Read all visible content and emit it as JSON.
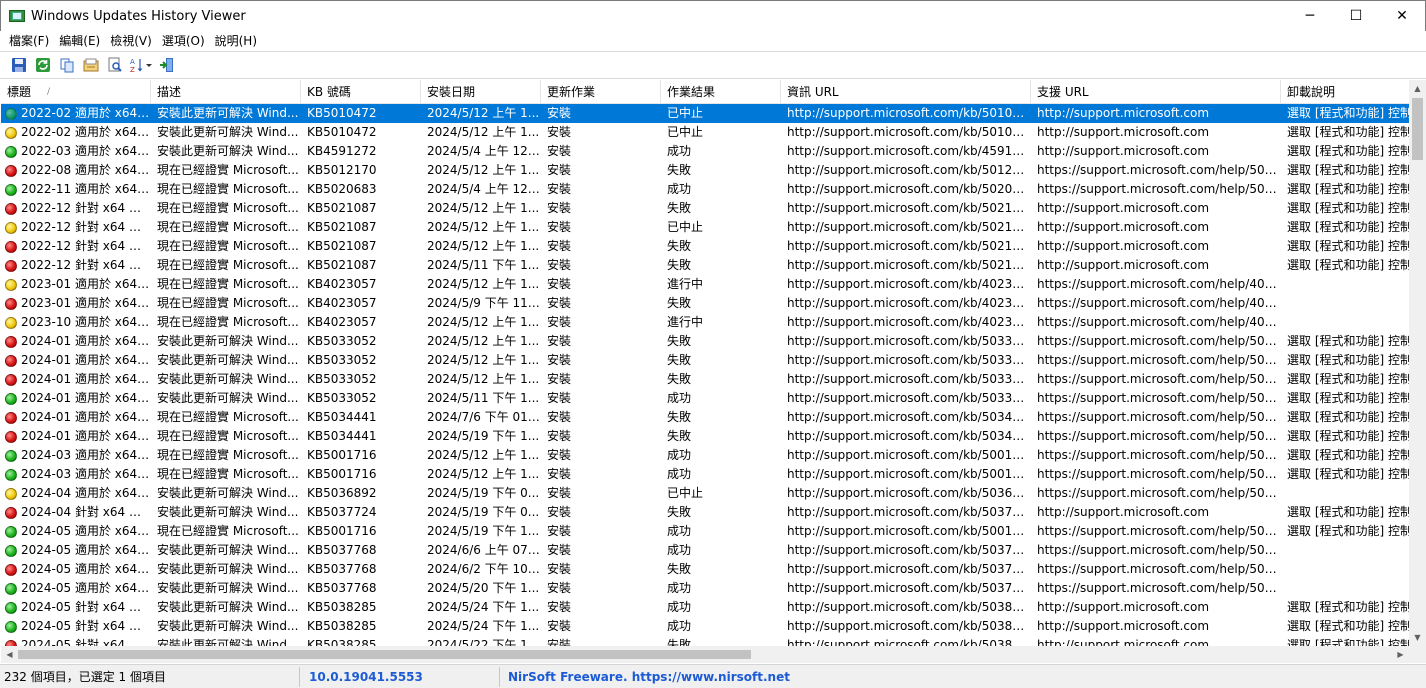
{
  "window": {
    "title": "Windows Updates History Viewer",
    "minimize_glyph": "─",
    "maximize_glyph": "☐",
    "close_glyph": "✕"
  },
  "menu": [
    "檔案(F)",
    "編輯(E)",
    "檢視(V)",
    "選項(O)",
    "說明(H)"
  ],
  "toolbar": {
    "icons": [
      "save-icon",
      "refresh-icon",
      "copy-icon",
      "properties-icon",
      "find-icon",
      "sort-icon",
      "exit-icon"
    ]
  },
  "columns": [
    {
      "label": "標題",
      "sort_indicator": "/"
    },
    {
      "label": "描述"
    },
    {
      "label": "KB 號碼"
    },
    {
      "label": "安裝日期"
    },
    {
      "label": "更新作業"
    },
    {
      "label": "作業結果"
    },
    {
      "label": "資訊 URL"
    },
    {
      "label": "支援 URL"
    },
    {
      "label": "卸載說明"
    }
  ],
  "status_colors": {
    "red": "#d81616",
    "green": "#1fb51f",
    "yellow": "#f3c90f",
    "selection": "#0078d7"
  },
  "rows": [
    {
      "status": "green",
      "selected": true,
      "cells": [
        "2022-02 適用於 x64 ...",
        "安裝此更新可解決 Wind...",
        "KB5010472",
        "2024/5/12 上午 1...",
        "安裝",
        "已中止",
        "http://support.microsoft.com/kb/5010472",
        "http://support.microsoft.com",
        "選取 [程式和功能] 控制"
      ]
    },
    {
      "status": "yellow",
      "cells": [
        "2022-02 適用於 x64 ...",
        "安裝此更新可解決 Wind...",
        "KB5010472",
        "2024/5/12 上午 1...",
        "安裝",
        "已中止",
        "http://support.microsoft.com/kb/5010472",
        "http://support.microsoft.com",
        "選取 [程式和功能] 控制"
      ]
    },
    {
      "status": "green",
      "cells": [
        "2022-03 適用於 x64 ...",
        "安裝此更新可解決 Wind...",
        "KB4591272",
        "2024/5/4 上午 12:...",
        "安裝",
        "成功",
        "http://support.microsoft.com/kb/4591272",
        "http://support.microsoft.com",
        "選取 [程式和功能] 控制"
      ]
    },
    {
      "status": "red",
      "cells": [
        "2022-08 適用於 x64 ...",
        "現在已經證實 Microsoft...",
        "KB5012170",
        "2024/5/12 上午 1...",
        "安裝",
        "失敗",
        "http://support.microsoft.com/kb/5012170",
        "https://support.microsoft.com/help/501...",
        "選取 [程式和功能] 控制"
      ]
    },
    {
      "status": "green",
      "cells": [
        "2022-11 適用於 x64 ...",
        "現在已經證實 Microsoft...",
        "KB5020683",
        "2024/5/4 上午 12:...",
        "安裝",
        "成功",
        "http://support.microsoft.com/kb/5020683",
        "https://support.microsoft.com/help/502...",
        "選取 [程式和功能] 控制"
      ]
    },
    {
      "status": "red",
      "cells": [
        "2022-12 針對 x64 之 ...",
        "現在已經證實 Microsoft...",
        "KB5021087",
        "2024/5/12 上午 1...",
        "安裝",
        "失敗",
        "http://support.microsoft.com/kb/5021087",
        "http://support.microsoft.com",
        "選取 [程式和功能] 控制"
      ]
    },
    {
      "status": "yellow",
      "cells": [
        "2022-12 針對 x64 之 ...",
        "現在已經證實 Microsoft...",
        "KB5021087",
        "2024/5/12 上午 1...",
        "安裝",
        "已中止",
        "http://support.microsoft.com/kb/5021087",
        "http://support.microsoft.com",
        "選取 [程式和功能] 控制"
      ]
    },
    {
      "status": "red",
      "cells": [
        "2022-12 針對 x64 之 ...",
        "現在已經證實 Microsoft...",
        "KB5021087",
        "2024/5/12 上午 1...",
        "安裝",
        "失敗",
        "http://support.microsoft.com/kb/5021087",
        "http://support.microsoft.com",
        "選取 [程式和功能] 控制"
      ]
    },
    {
      "status": "red",
      "cells": [
        "2022-12 針對 x64 之 ...",
        "現在已經證實 Microsoft...",
        "KB5021087",
        "2024/5/11 下午 1...",
        "安裝",
        "失敗",
        "http://support.microsoft.com/kb/5021087",
        "http://support.microsoft.com",
        "選取 [程式和功能] 控制"
      ]
    },
    {
      "status": "yellow",
      "cells": [
        "2023-01 適用於 x64 ...",
        "現在已經證實 Microsoft...",
        "KB4023057",
        "2024/5/12 上午 1...",
        "安裝",
        "進行中",
        "http://support.microsoft.com/kb/4023057",
        "https://support.microsoft.com/help/402...",
        ""
      ]
    },
    {
      "status": "red",
      "cells": [
        "2023-01 適用於 x64 ...",
        "現在已經證實 Microsoft...",
        "KB4023057",
        "2024/5/9 下午 11:...",
        "安裝",
        "失敗",
        "http://support.microsoft.com/kb/4023057",
        "https://support.microsoft.com/help/402...",
        ""
      ]
    },
    {
      "status": "yellow",
      "cells": [
        "2023-10 適用於 x64 ...",
        "現在已經證實 Microsoft...",
        "KB4023057",
        "2024/5/12 上午 1...",
        "安裝",
        "進行中",
        "http://support.microsoft.com/kb/4023057",
        "https://support.microsoft.com/help/402...",
        ""
      ]
    },
    {
      "status": "red",
      "cells": [
        "2024-01 適用於 x64 ...",
        "安裝此更新可解決 Wind...",
        "KB5033052",
        "2024/5/12 上午 1...",
        "安裝",
        "失敗",
        "http://support.microsoft.com/kb/5033052",
        "https://support.microsoft.com/help/503...",
        "選取 [程式和功能] 控制"
      ]
    },
    {
      "status": "red",
      "cells": [
        "2024-01 適用於 x64 ...",
        "安裝此更新可解決 Wind...",
        "KB5033052",
        "2024/5/12 上午 1...",
        "安裝",
        "失敗",
        "http://support.microsoft.com/kb/5033052",
        "https://support.microsoft.com/help/503...",
        "選取 [程式和功能] 控制"
      ]
    },
    {
      "status": "red",
      "cells": [
        "2024-01 適用於 x64 ...",
        "安裝此更新可解決 Wind...",
        "KB5033052",
        "2024/5/12 上午 1...",
        "安裝",
        "失敗",
        "http://support.microsoft.com/kb/5033052",
        "https://support.microsoft.com/help/503...",
        "選取 [程式和功能] 控制"
      ]
    },
    {
      "status": "green",
      "cells": [
        "2024-01 適用於 x64 ...",
        "安裝此更新可解決 Wind...",
        "KB5033052",
        "2024/5/11 下午 1...",
        "安裝",
        "成功",
        "http://support.microsoft.com/kb/5033052",
        "https://support.microsoft.com/help/503...",
        "選取 [程式和功能] 控制"
      ]
    },
    {
      "status": "red",
      "cells": [
        "2024-01 適用於 x64 ...",
        "現在已經證實 Microsoft...",
        "KB5034441",
        "2024/7/6 下午 01:...",
        "安裝",
        "失敗",
        "http://support.microsoft.com/kb/5034441",
        "https://support.microsoft.com/help/503...",
        "選取 [程式和功能] 控制"
      ]
    },
    {
      "status": "red",
      "cells": [
        "2024-01 適用於 x64 ...",
        "現在已經證實 Microsoft...",
        "KB5034441",
        "2024/5/19 下午 1...",
        "安裝",
        "失敗",
        "http://support.microsoft.com/kb/5034441",
        "https://support.microsoft.com/help/503...",
        "選取 [程式和功能] 控制"
      ]
    },
    {
      "status": "green",
      "cells": [
        "2024-03 適用於 x64 ...",
        "現在已經證實 Microsoft...",
        "KB5001716",
        "2024/5/12 上午 1...",
        "安裝",
        "成功",
        "http://support.microsoft.com/kb/5001716",
        "https://support.microsoft.com/help/500...",
        "選取 [程式和功能] 控制"
      ]
    },
    {
      "status": "green",
      "cells": [
        "2024-03 適用於 x64 ...",
        "現在已經證實 Microsoft...",
        "KB5001716",
        "2024/5/12 上午 1...",
        "安裝",
        "成功",
        "http://support.microsoft.com/kb/5001716",
        "https://support.microsoft.com/help/500...",
        "選取 [程式和功能] 控制"
      ]
    },
    {
      "status": "yellow",
      "cells": [
        "2024-04 適用於 x64 ...",
        "安裝此更新可解決 Wind...",
        "KB5036892",
        "2024/5/19 下午 0...",
        "安裝",
        "已中止",
        "http://support.microsoft.com/kb/5036892",
        "https://support.microsoft.com/help/503...",
        ""
      ]
    },
    {
      "status": "red",
      "cells": [
        "2024-04 針對 x64 之 ...",
        "安裝此更新可解決 Wind...",
        "KB5037724",
        "2024/5/19 下午 0...",
        "安裝",
        "失敗",
        "http://support.microsoft.com/kb/5037724",
        "http://support.microsoft.com",
        "選取 [程式和功能] 控制"
      ]
    },
    {
      "status": "green",
      "cells": [
        "2024-05 適用於 x64 ...",
        "現在已經證實 Microsoft...",
        "KB5001716",
        "2024/5/19 下午 1...",
        "安裝",
        "成功",
        "http://support.microsoft.com/kb/5001716",
        "https://support.microsoft.com/help/500...",
        "選取 [程式和功能] 控制"
      ]
    },
    {
      "status": "green",
      "cells": [
        "2024-05 適用於 x64 ...",
        "安裝此更新可解決 Wind...",
        "KB5037768",
        "2024/6/6 上午 07:...",
        "安裝",
        "成功",
        "http://support.microsoft.com/kb/5037768",
        "https://support.microsoft.com/help/503...",
        ""
      ]
    },
    {
      "status": "red",
      "cells": [
        "2024-05 適用於 x64 ...",
        "安裝此更新可解決 Wind...",
        "KB5037768",
        "2024/6/2 下午 10:...",
        "安裝",
        "失敗",
        "http://support.microsoft.com/kb/5037768",
        "https://support.microsoft.com/help/503...",
        ""
      ]
    },
    {
      "status": "green",
      "cells": [
        "2024-05 適用於 x64 ...",
        "安裝此更新可解決 Wind...",
        "KB5037768",
        "2024/5/20 下午 1...",
        "安裝",
        "成功",
        "http://support.microsoft.com/kb/5037768",
        "https://support.microsoft.com/help/503...",
        ""
      ]
    },
    {
      "status": "green",
      "cells": [
        "2024-05 針對 x64 之 ...",
        "安裝此更新可解決 Wind...",
        "KB5038285",
        "2024/5/24 下午 1...",
        "安裝",
        "成功",
        "http://support.microsoft.com/kb/5038285",
        "http://support.microsoft.com",
        "選取 [程式和功能] 控制"
      ]
    },
    {
      "status": "green",
      "cells": [
        "2024-05 針對 x64 之 ...",
        "安裝此更新可解決 Wind...",
        "KB5038285",
        "2024/5/24 下午 1...",
        "安裝",
        "成功",
        "http://support.microsoft.com/kb/5038285",
        "http://support.microsoft.com",
        "選取 [程式和功能] 控制"
      ]
    },
    {
      "status": "red",
      "cells": [
        "2024-05 針對 x64 之 ...",
        "安裝此更新可解決 Wind...",
        "KB5038285",
        "2024/5/22 下午 1...",
        "安裝",
        "失敗",
        "http://support.microsoft.com/kb/5038285",
        "http://support.microsoft.com",
        "選取 [程式和功能] 控制"
      ]
    }
  ],
  "status": {
    "items": "232 個項目，已選定 1 個項目",
    "version": "10.0.19041.5553",
    "credit": "NirSoft Freeware. https://www.nirsoft.net"
  }
}
